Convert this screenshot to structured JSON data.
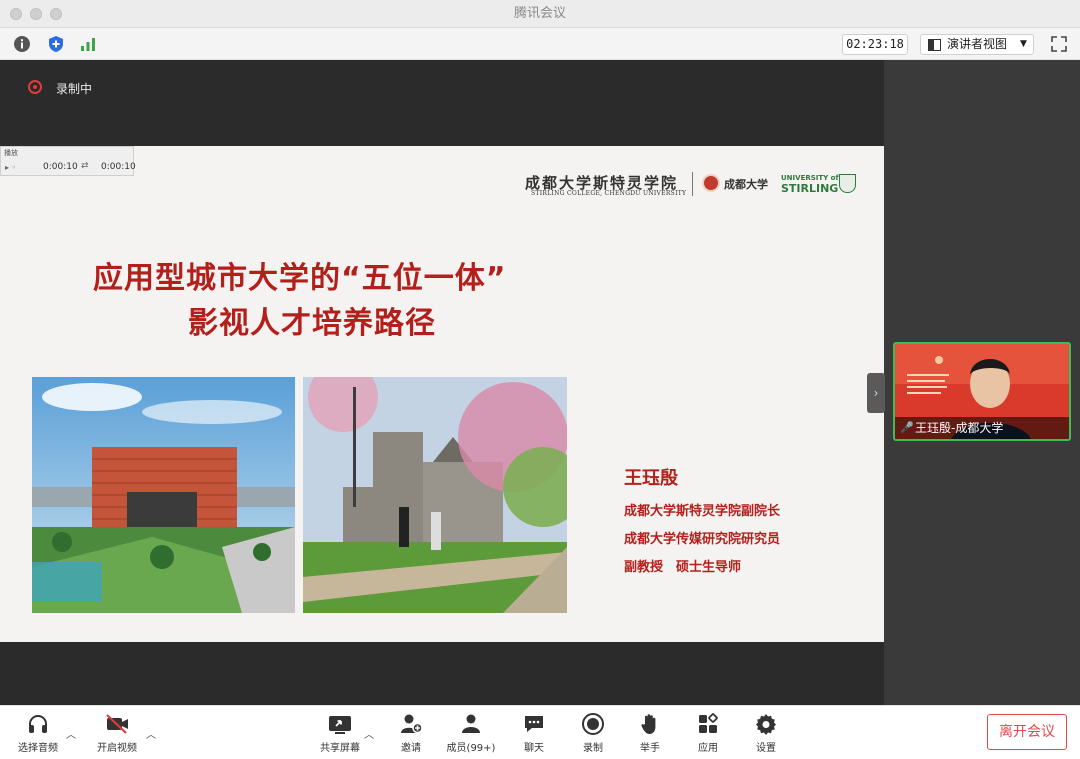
{
  "window": {
    "title": "腾讯会议"
  },
  "toolbar": {
    "timer": "02:23:18",
    "view_mode": "演讲者视图"
  },
  "recording": {
    "label": "录制中"
  },
  "mini_player": {
    "label": "播放",
    "time_current": "0:00:10",
    "time_total": "0:00:10"
  },
  "slide": {
    "title_line1": "应用型城市大学的“五位一体”",
    "title_line2": "影视人才培养路径",
    "logo_cn": "成都大学斯特灵学院",
    "logo_en": "STIRLING COLLEGE, CHENGDU UNIVERSITY",
    "logo_cdu": "成都大学",
    "logo_stirling_small": "UNIVERSITY of",
    "logo_stirling_big": "STIRLING",
    "speaker_name": "王珏殷",
    "speaker_role1": "成都大学斯特灵学院副院长",
    "speaker_role2": "成都大学传媒研究院研究员",
    "speaker_role3": "副教授　硕士生导师"
  },
  "participant": {
    "name": "王珏殷-成都大学"
  },
  "bottom": {
    "audio": "选择音频",
    "video": "开启视频",
    "share": "共享屏幕",
    "invite": "邀请",
    "members": "成员(99+)",
    "chat": "聊天",
    "record": "录制",
    "raise_hand": "举手",
    "apps": "应用",
    "settings": "设置",
    "leave": "离开会议"
  },
  "colors": {
    "accent_red": "#b3201c",
    "leave_red": "#e24a4a",
    "active_green": "#3fbd55"
  }
}
